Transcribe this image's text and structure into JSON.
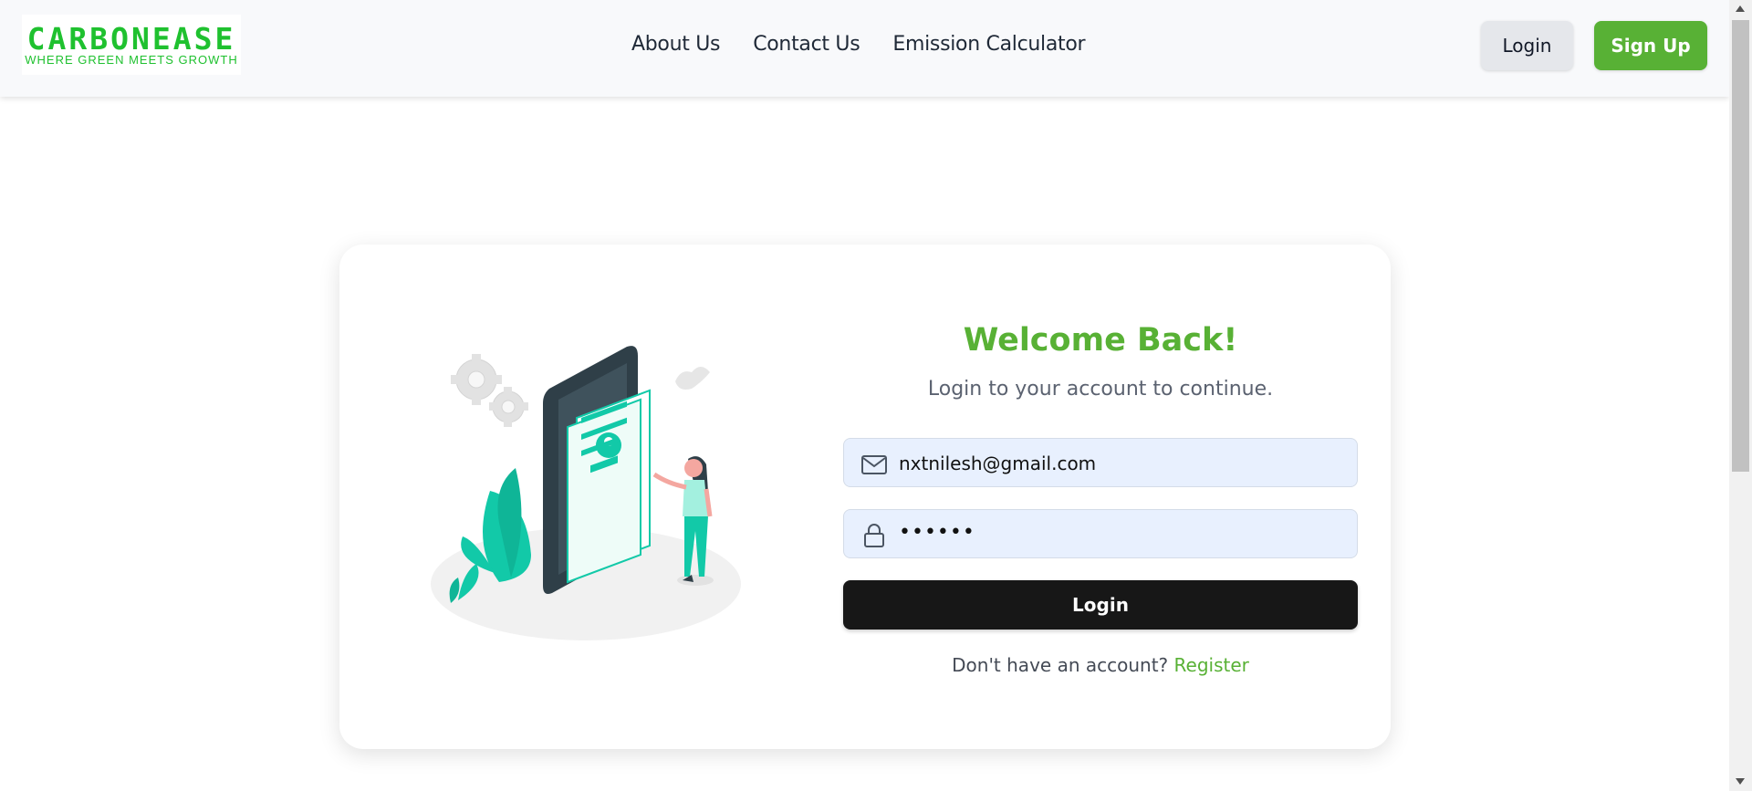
{
  "brand": {
    "name": "CARBONEASE",
    "tagline": "WHERE GREEN MEETS GROWTH",
    "color": "#1fc12f"
  },
  "nav": {
    "links": [
      {
        "label": "About Us"
      },
      {
        "label": "Contact Us"
      },
      {
        "label": "Emission Calculator"
      }
    ],
    "login_label": "Login",
    "signup_label": "Sign Up"
  },
  "login_card": {
    "title": "Welcome Back!",
    "subtitle": "Login to your account to continue.",
    "email_value": "nxtnilesh@gmail.com",
    "password_masked": "••••••",
    "submit_label": "Login",
    "register_prompt": "Don't have an account?",
    "register_link": "Register"
  },
  "colors": {
    "accent": "#58b135",
    "primary_button": "#171717",
    "input_bg": "#e8f0fe",
    "illustration_teal": "#12c9a8"
  },
  "icons": {
    "email": "mail-icon",
    "password": "lock-icon"
  }
}
